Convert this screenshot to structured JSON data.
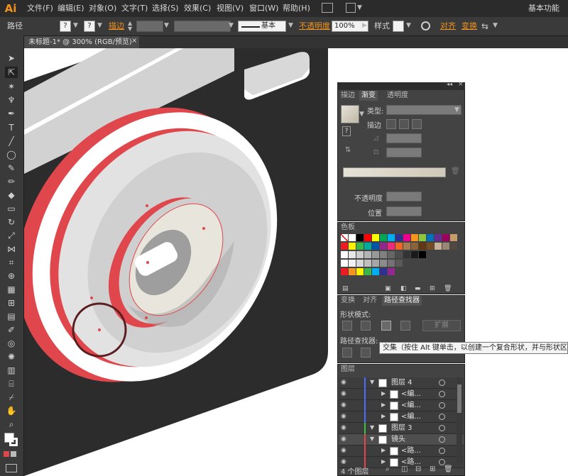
{
  "app": {
    "logo": "Ai",
    "workspace": "基本功能"
  },
  "menu": [
    "文件(F)",
    "编辑(E)",
    "对象(O)",
    "文字(T)",
    "选择(S)",
    "效果(C)",
    "视图(V)",
    "窗口(W)",
    "帮助(H)"
  ],
  "control": {
    "selection": "路径",
    "stroke_label": "描边",
    "stroke_profile": "基本",
    "opacity_label": "不透明度",
    "opacity_value": "100%",
    "style_label": "样式",
    "align_label": "对齐",
    "transform_label": "变换",
    "q1": "?",
    "q2": "?"
  },
  "document": {
    "tab_title": "未标题-1* @ 300% (RGB/预览)",
    "close": "×"
  },
  "gradient_panel": {
    "tabs": [
      "描边",
      "渐变",
      "透明度"
    ],
    "active_tab": 1,
    "type_label": "类型:",
    "stroke_label": "描边",
    "opacity_label": "不透明度",
    "position_label": "位置"
  },
  "swatches_panel": {
    "title": "色板"
  },
  "pathfinder_panel": {
    "tabs": [
      "变换",
      "对齐",
      "路径查找器"
    ],
    "shape_modes_label": "形状模式:",
    "expand_label": "扩展",
    "pathfinders_label": "路径查找器:",
    "tooltip": "交集（按住 Alt 键单击，以创建一个复合形状，并与形状区域交"
  },
  "layers_panel": {
    "title": "图层",
    "rows": [
      {
        "name": "图层 4",
        "indent": 0,
        "color": "#4a6cff"
      },
      {
        "name": "<编...",
        "indent": 1,
        "color": "#4a6cff"
      },
      {
        "name": "<编...",
        "indent": 1,
        "color": "#4a6cff"
      },
      {
        "name": "<编...",
        "indent": 1,
        "color": "#4a6cff"
      },
      {
        "name": "图层 3",
        "indent": 0,
        "color": "#39c33f"
      },
      {
        "name": "镜头",
        "indent": 0,
        "color": "#e0474c"
      },
      {
        "name": "<路...",
        "indent": 1,
        "color": "#e0474c"
      },
      {
        "name": "<路...",
        "indent": 1,
        "color": "#e0474c"
      }
    ],
    "footer": "4 个图层"
  },
  "colors": {
    "accent": "#f1931d",
    "lens_red": "#e0474c",
    "body_dark": "#2c2c2c"
  }
}
